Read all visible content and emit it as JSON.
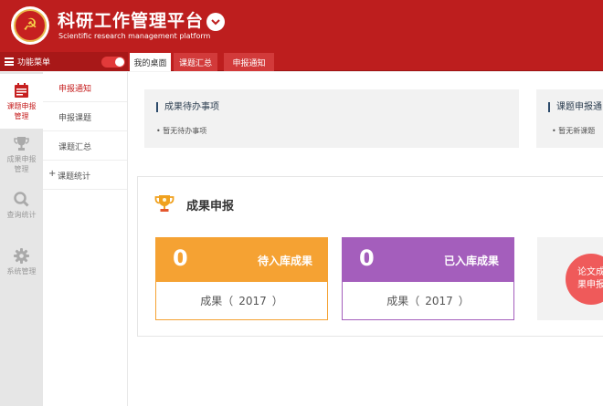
{
  "header": {
    "title": "科研工作管理平台",
    "subtitle": "Scientific research management platform",
    "brand_color": "#bd1e1e",
    "dropdown_icon": "chevron-down-icon"
  },
  "menubar": {
    "label": "功能菜单",
    "toggle_on": true,
    "tabs": [
      {
        "label": "我的桌面",
        "active": true
      },
      {
        "label": "课题汇总",
        "active": false
      },
      {
        "label": "申报通知",
        "active": false
      }
    ]
  },
  "iconbar": {
    "items": [
      {
        "label": "课题申报管理",
        "icon": "calendar-icon",
        "active": true
      },
      {
        "label": "成果申报管理",
        "icon": "trophy-icon",
        "active": false
      },
      {
        "label": "查询统计",
        "icon": "search-icon",
        "active": false
      },
      {
        "label": "系统管理",
        "icon": "gear-icon",
        "active": false
      }
    ]
  },
  "submenu": {
    "items": [
      {
        "label": "申报通知",
        "active": true
      },
      {
        "label": "申报课题"
      },
      {
        "label": "课题汇总"
      },
      {
        "label": "课题统计",
        "prefix": "+"
      }
    ]
  },
  "todos": [
    {
      "title": "成果待办事项",
      "body": "• 暂无待办事项"
    },
    {
      "title": "课题申报通",
      "body": "• 暂无新课题"
    }
  ],
  "results_panel": {
    "title": "成果申报",
    "cards": [
      {
        "count": "0",
        "label": "待入库成果",
        "footer_label": "成果（",
        "year": "2017",
        "close": "）",
        "color": "#f5a233"
      },
      {
        "count": "0",
        "label": "已入库成果",
        "footer_label": "成果（",
        "year": "2017",
        "close": "）",
        "color": "#a45ebc"
      }
    ],
    "paper_button": "论文成果申报",
    "paper_color": "#ef5a5a"
  }
}
